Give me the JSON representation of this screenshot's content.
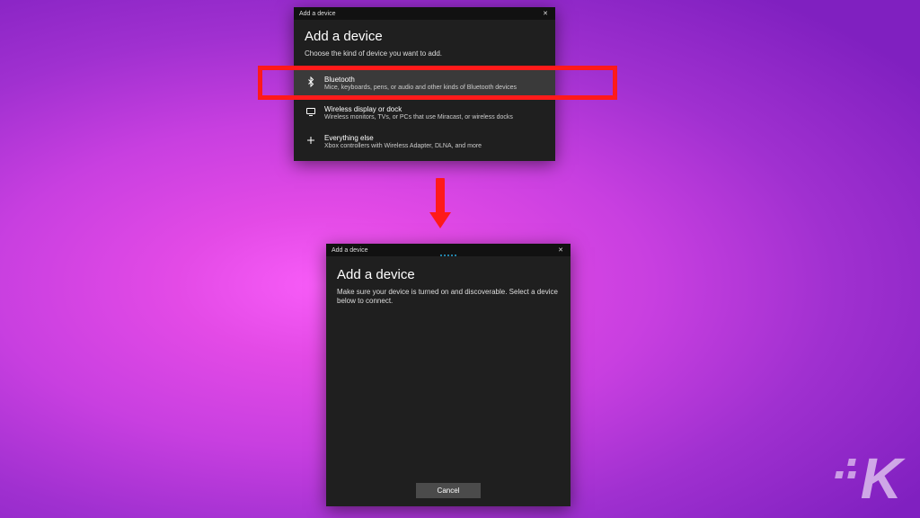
{
  "dialog1": {
    "titlebar": "Add a device",
    "heading": "Add a device",
    "subtext": "Choose the kind of device you want to add.",
    "options": [
      {
        "title": "Bluetooth",
        "desc": "Mice, keyboards, pens, or audio and other kinds of Bluetooth devices"
      },
      {
        "title": "Wireless display or dock",
        "desc": "Wireless monitors, TVs, or PCs that use Miracast, or wireless docks"
      },
      {
        "title": "Everything else",
        "desc": "Xbox controllers with Wireless Adapter, DLNA, and more"
      }
    ]
  },
  "dialog2": {
    "titlebar": "Add a device",
    "heading": "Add a device",
    "subtext": "Make sure your device is turned on and discoverable. Select a device below to connect.",
    "cancel": "Cancel"
  },
  "close_glyph": "✕"
}
